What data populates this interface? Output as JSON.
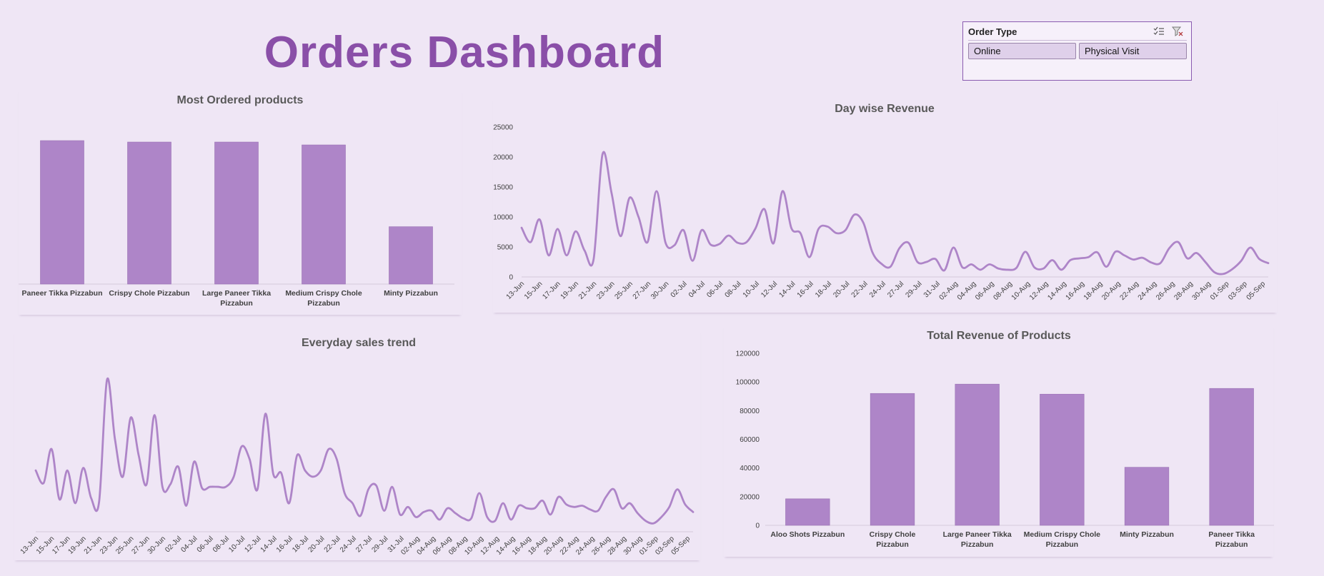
{
  "header": {
    "title": "Orders Dashboard"
  },
  "slicer": {
    "title": "Order Type",
    "icons": [
      "multi-select-icon",
      "clear-filter-icon"
    ],
    "options": [
      "Online",
      "Physical Visit"
    ]
  },
  "colors": {
    "background": "#efe6f5",
    "accent": "#ae85c8",
    "line": "#ae85c8",
    "title": "#8a4fa8"
  },
  "chart_data": [
    {
      "id": "most-ordered",
      "type": "bar",
      "title": "Most Ordered products",
      "categories": [
        "Paneer Tikka Pizzabun",
        "Crispy Chole Pizzabun",
        "Large Paneer Tikka Pizzabun",
        "Medium Crispy Chole Pizzabun",
        "Minty Pizzabun"
      ],
      "values": [
        100,
        99,
        99,
        97,
        40
      ],
      "ylim": [
        0,
        100
      ],
      "show_axis": false
    },
    {
      "id": "day-revenue",
      "type": "line",
      "title": "Day wise Revenue",
      "ylim": [
        0,
        25000
      ],
      "yticks": [
        0,
        5000,
        10000,
        15000,
        20000,
        25000
      ],
      "xtick_labels": [
        "13-Jun",
        "15-Jun",
        "17-Jun",
        "19-Jun",
        "21-Jun",
        "23-Jun",
        "25-Jun",
        "27-Jun",
        "30-Jun",
        "02-Jul",
        "04-Jul",
        "06-Jul",
        "08-Jul",
        "10-Jul",
        "12-Jul",
        "14-Jul",
        "16-Jul",
        "18-Jul",
        "20-Jul",
        "22-Jul",
        "24-Jul",
        "27-Jul",
        "29-Jul",
        "31-Jul",
        "02-Aug",
        "04-Aug",
        "06-Aug",
        "08-Aug",
        "10-Aug",
        "12-Aug",
        "14-Aug",
        "16-Aug",
        "18-Aug",
        "20-Aug",
        "22-Aug",
        "24-Aug",
        "26-Aug",
        "28-Aug",
        "30-Aug",
        "01-Sep",
        "03-Sep",
        "05-Sep"
      ],
      "values": [
        8200,
        5800,
        9600,
        3600,
        8000,
        3600,
        7600,
        4400,
        2900,
        20500,
        14000,
        6800,
        13200,
        10000,
        5800,
        14300,
        5700,
        5300,
        7800,
        2700,
        7800,
        5400,
        5500,
        6900,
        5700,
        5800,
        8100,
        11300,
        5600,
        14300,
        8100,
        7300,
        3300,
        8000,
        8400,
        7300,
        7800,
        10400,
        9000,
        4100,
        2200,
        1700,
        4800,
        5700,
        2500,
        2500,
        3000,
        1100,
        4900,
        1600,
        2100,
        1200,
        2100,
        1400,
        1200,
        1500,
        4200,
        1600,
        1400,
        2800,
        1200,
        2800,
        3100,
        3300,
        4100,
        1700,
        4200,
        3600,
        2900,
        3200,
        2400,
        2300,
        4800,
        5800,
        3100,
        4000,
        2500,
        800,
        500,
        1300,
        2700,
        4900,
        3000,
        2300
      ]
    },
    {
      "id": "everyday-sales",
      "type": "line",
      "title": "Everyday sales trend",
      "show_axis": false,
      "xtick_labels": [
        "13-Jun",
        "15-Jun",
        "17-Jun",
        "19-Jun",
        "21-Jun",
        "23-Jun",
        "25-Jun",
        "27-Jun",
        "30-Jun",
        "02-Jul",
        "04-Jul",
        "06-Jul",
        "08-Jul",
        "10-Jul",
        "12-Jul",
        "14-Jul",
        "16-Jul",
        "18-Jul",
        "20-Jul",
        "22-Jul",
        "24-Jul",
        "27-Jul",
        "29-Jul",
        "31-Jul",
        "02-Aug",
        "04-Aug",
        "06-Aug",
        "08-Aug",
        "10-Aug",
        "12-Aug",
        "14-Aug",
        "16-Aug",
        "18-Aug",
        "20-Aug",
        "22-Aug",
        "24-Aug",
        "26-Aug",
        "28-Aug",
        "30-Aug",
        "01-Sep",
        "03-Sep",
        "05-Sep"
      ],
      "values": [
        43,
        33,
        60,
        20,
        43,
        17,
        45,
        21,
        18,
        115,
        68,
        38,
        85,
        55,
        32,
        87,
        30,
        32,
        46,
        15,
        50,
        29,
        30,
        30,
        30,
        38,
        62,
        52,
        28,
        88,
        40,
        41,
        17,
        55,
        43,
        38,
        43,
        60,
        52,
        25,
        17,
        7,
        28,
        31,
        11,
        30,
        8,
        14,
        6,
        10,
        11,
        4,
        13,
        9,
        5,
        5,
        25,
        6,
        3,
        17,
        4,
        15,
        13,
        13,
        19,
        8,
        22,
        16,
        14,
        15,
        12,
        11,
        22,
        28,
        13,
        17,
        9,
        3,
        1,
        6,
        14,
        28,
        16,
        10
      ]
    },
    {
      "id": "product-revenue",
      "type": "bar",
      "title": "Total Revenue of Products",
      "categories": [
        "Aloo Shots Pizzabun",
        "Crispy Chole Pizzabun",
        "Large Paneer Tikka Pizzabun",
        "Medium Crispy Chole Pizzabun",
        "Minty Pizzabun",
        "Paneer Tikka Pizzabun"
      ],
      "values": [
        18500,
        92000,
        98500,
        91500,
        40500,
        95500
      ],
      "ylim": [
        0,
        120000
      ],
      "yticks": [
        0,
        20000,
        40000,
        60000,
        80000,
        100000,
        120000
      ]
    }
  ]
}
